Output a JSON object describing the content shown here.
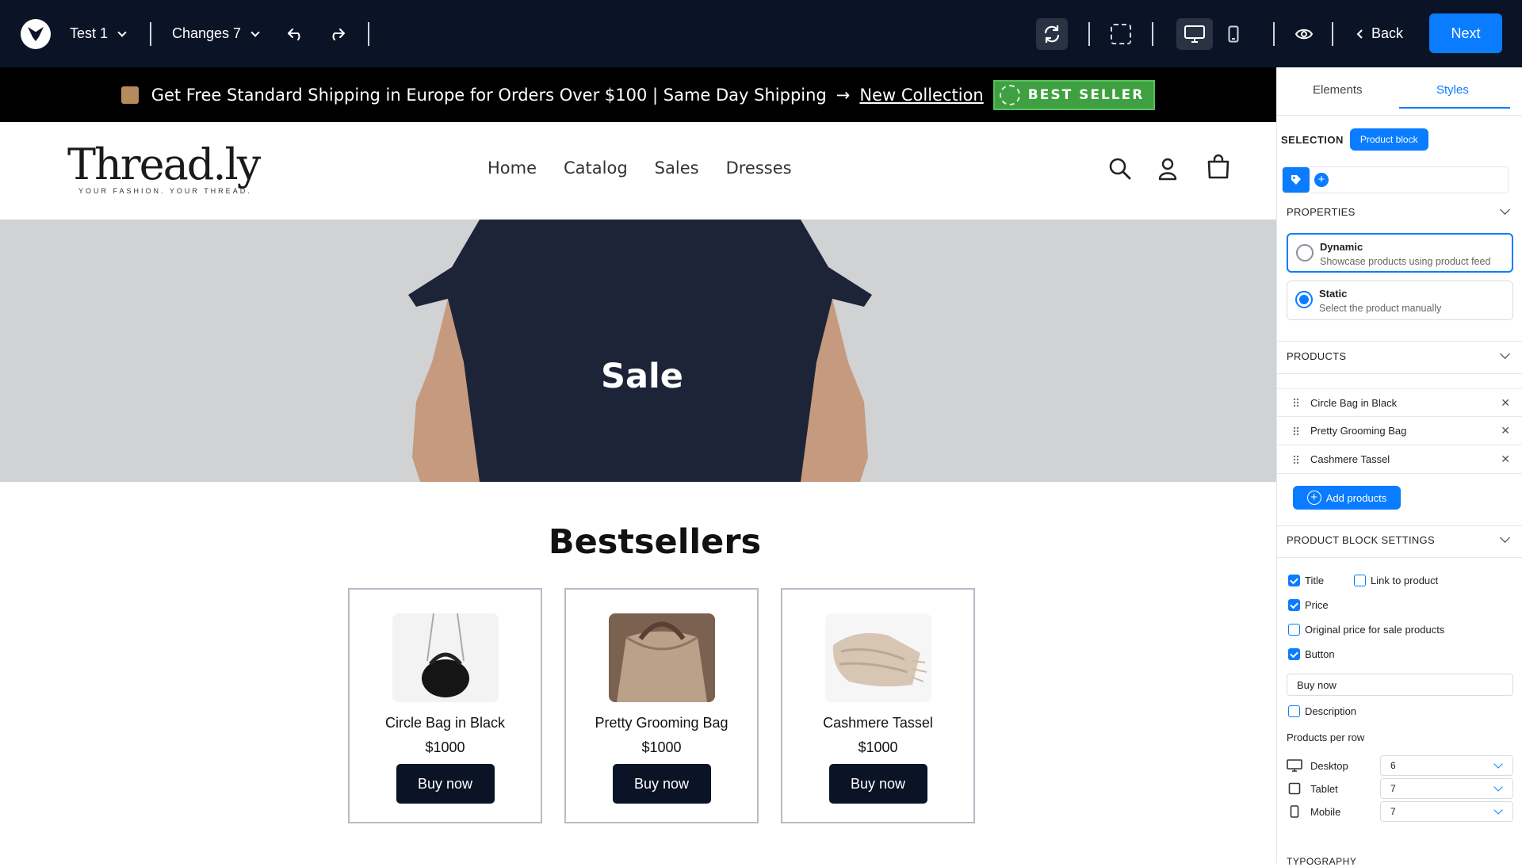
{
  "topbar": {
    "project_name": "Test 1",
    "changes_label": "Changes 7",
    "back_label": "Back",
    "next_label": "Next"
  },
  "announcement": {
    "text": "Get Free Standard Shipping in Europe for Orders Over $100 | Same Day Shipping",
    "arrow": "→",
    "link_text": "New Collection",
    "badge_text": "BEST SELLER"
  },
  "header": {
    "brand_name": "Thread.ly",
    "brand_tagline": "YOUR FASHION. YOUR THREAD.",
    "nav": [
      "Home",
      "Catalog",
      "Sales",
      "Dresses"
    ]
  },
  "hero": {
    "title": "Sale"
  },
  "bestsellers": {
    "title": "Bestsellers",
    "products": [
      {
        "name": "Circle Bag in Black",
        "price": "$1000",
        "button": "Buy now",
        "image": "black-bag"
      },
      {
        "name": "Pretty Grooming Bag",
        "price": "$1000",
        "button": "Buy now",
        "image": "tan-bag"
      },
      {
        "name": "Cashmere Tassel",
        "price": "$1000",
        "button": "Buy now",
        "image": "beige-scarf"
      }
    ]
  },
  "panel": {
    "tabs": [
      "Elements",
      "Styles"
    ],
    "active_tab": "Styles",
    "selection_label": "SELECTION",
    "selection_value": "Product block",
    "properties_title": "PROPERTIES",
    "options": [
      {
        "title": "Dynamic",
        "sub": "Showcase products using product feed",
        "selected": false
      },
      {
        "title": "Static",
        "sub": "Select the product manually",
        "selected": true
      }
    ],
    "products_title": "PRODUCTS",
    "products": [
      "Circle Bag in Black",
      "Pretty Grooming Bag",
      "Cashmere Tassel"
    ],
    "add_products_label": "Add products",
    "block_settings_title": "PRODUCT BLOCK SETTINGS",
    "checkboxes": {
      "title": {
        "label": "Title",
        "checked": true
      },
      "link": {
        "label": "Link to product",
        "checked": false
      },
      "price": {
        "label": "Price",
        "checked": true
      },
      "original_price": {
        "label": "Original price for sale products",
        "checked": false
      },
      "button": {
        "label": "Button",
        "checked": true
      },
      "description": {
        "label": "Description",
        "checked": false
      }
    },
    "button_text_value": "Buy now",
    "products_per_row_label": "Products per row",
    "per_row": [
      {
        "device": "Desktop",
        "value": "6"
      },
      {
        "device": "Tablet",
        "value": "7"
      },
      {
        "device": "Mobile",
        "value": "7"
      }
    ],
    "typography_title": "TYPOGRAPHY"
  },
  "colors": {
    "topbar_bg": "#0b1426",
    "accent": "#0a7cff",
    "badge_green": "#3ea040",
    "hero_bg": "#d1d2d4",
    "shirt_navy": "#1d2438"
  }
}
